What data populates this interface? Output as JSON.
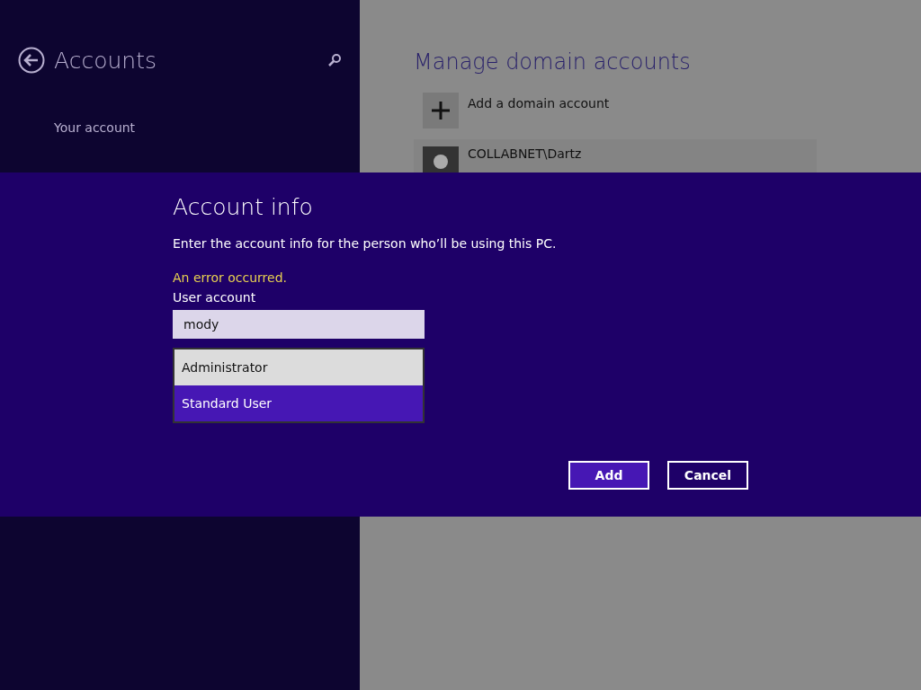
{
  "sidebar": {
    "title": "Accounts",
    "items": [
      {
        "label": "Your account"
      }
    ]
  },
  "main": {
    "title": "Manage domain accounts",
    "add_label": "Add a domain account",
    "accounts": [
      {
        "name": "COLLABNET\\Dartz"
      }
    ]
  },
  "dialog": {
    "title": "Account info",
    "description": "Enter the account info for the person who’ll be using this PC.",
    "error": "An error occurred.",
    "field_label": "User account",
    "field_value": "mody",
    "options": [
      {
        "label": "Administrator",
        "selected": false
      },
      {
        "label": "Standard User",
        "selected": true
      }
    ],
    "buttons": [
      {
        "label": "Add",
        "kind": "primary"
      },
      {
        "label": "Cancel",
        "kind": "secondary"
      }
    ]
  }
}
